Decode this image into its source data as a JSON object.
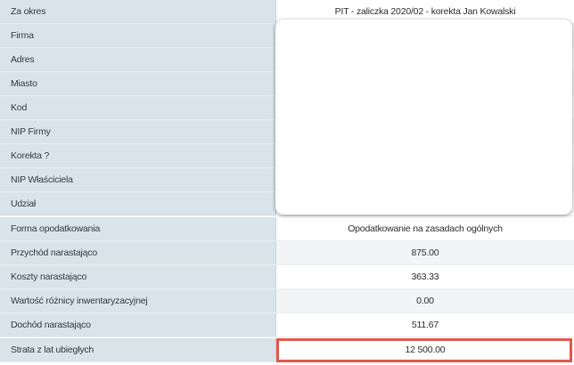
{
  "rows": [
    {
      "label": "Za okres",
      "value": "PIT - zaliczka 2020/02 - korekta Jan Kowalski"
    },
    {
      "label": "Firma",
      "value": ""
    },
    {
      "label": "Adres",
      "value": ""
    },
    {
      "label": "Miasto",
      "value": ""
    },
    {
      "label": "Kod",
      "value": ""
    },
    {
      "label": "NIP Firmy",
      "value": ""
    },
    {
      "label": "Korekta ?",
      "value": ""
    },
    {
      "label": "NIP Właściciela",
      "value": ""
    },
    {
      "label": "Udział",
      "value": ""
    },
    {
      "label": "Forma opodatkowania",
      "value": "Opodatkowanie na zasadach ogólnych"
    },
    {
      "label": "Przychód narastająco",
      "value": "875.00"
    },
    {
      "label": "Koszty narastająco",
      "value": "363.33"
    },
    {
      "label": "Wartość różnicy inwentaryzacyjnej",
      "value": "0.00"
    },
    {
      "label": "Dochód narastająco",
      "value": "511.67"
    },
    {
      "label": "Strata z lat ubiegłych",
      "value": "12 500.00"
    }
  ],
  "colors": {
    "label_bg": "#d9e4ea",
    "highlight": "#e2574c"
  }
}
